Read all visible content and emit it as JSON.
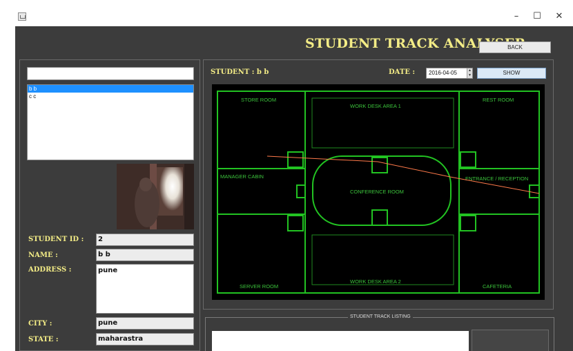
{
  "window": {
    "minimize_glyph": "–",
    "maximize_glyph": "☐",
    "close_glyph": "✕"
  },
  "header": {
    "title": "STUDENT  TRACK ANALYSER",
    "back_label": "BACK"
  },
  "left": {
    "search_value": "",
    "students": [
      "b b",
      "c c"
    ],
    "selected_index": 0,
    "fields": {
      "student_id_label": "STUDENT ID :",
      "student_id_value": "2",
      "name_label": "NAME :",
      "name_value": "b b",
      "address_label": "ADDRESS :",
      "address_value": "pune",
      "city_label": "CITY :",
      "city_value": "pune",
      "state_label": "STATE :",
      "state_value": "maharastra"
    }
  },
  "right": {
    "student_caption": "STUDENT : b b",
    "date_label": "DATE :",
    "date_value": "2016-04-05",
    "show_label": "SHOW",
    "rooms": {
      "store_room": "STORE ROOM",
      "work_desk_1": "WORK DESK AREA 1",
      "rest_room": "REST ROOM",
      "manager_cabin": "MANAGER CABIN",
      "conference_room": "CONFERENCE ROOM",
      "entrance": "ENTRANCE / RECEPTION",
      "server_room": "SERVER ROOM",
      "work_desk_2": "WORK DESK AREA 2",
      "cafeteria": "CAFETERIA"
    }
  },
  "listing": {
    "legend": "STUDENT TRACK LISTING"
  },
  "colors": {
    "background": "#3c3c3c",
    "label_yellow": "#f3ec86",
    "plan_green": "#22c322",
    "track_line": "#ff7a4a",
    "selection_blue": "#1e90ff"
  }
}
